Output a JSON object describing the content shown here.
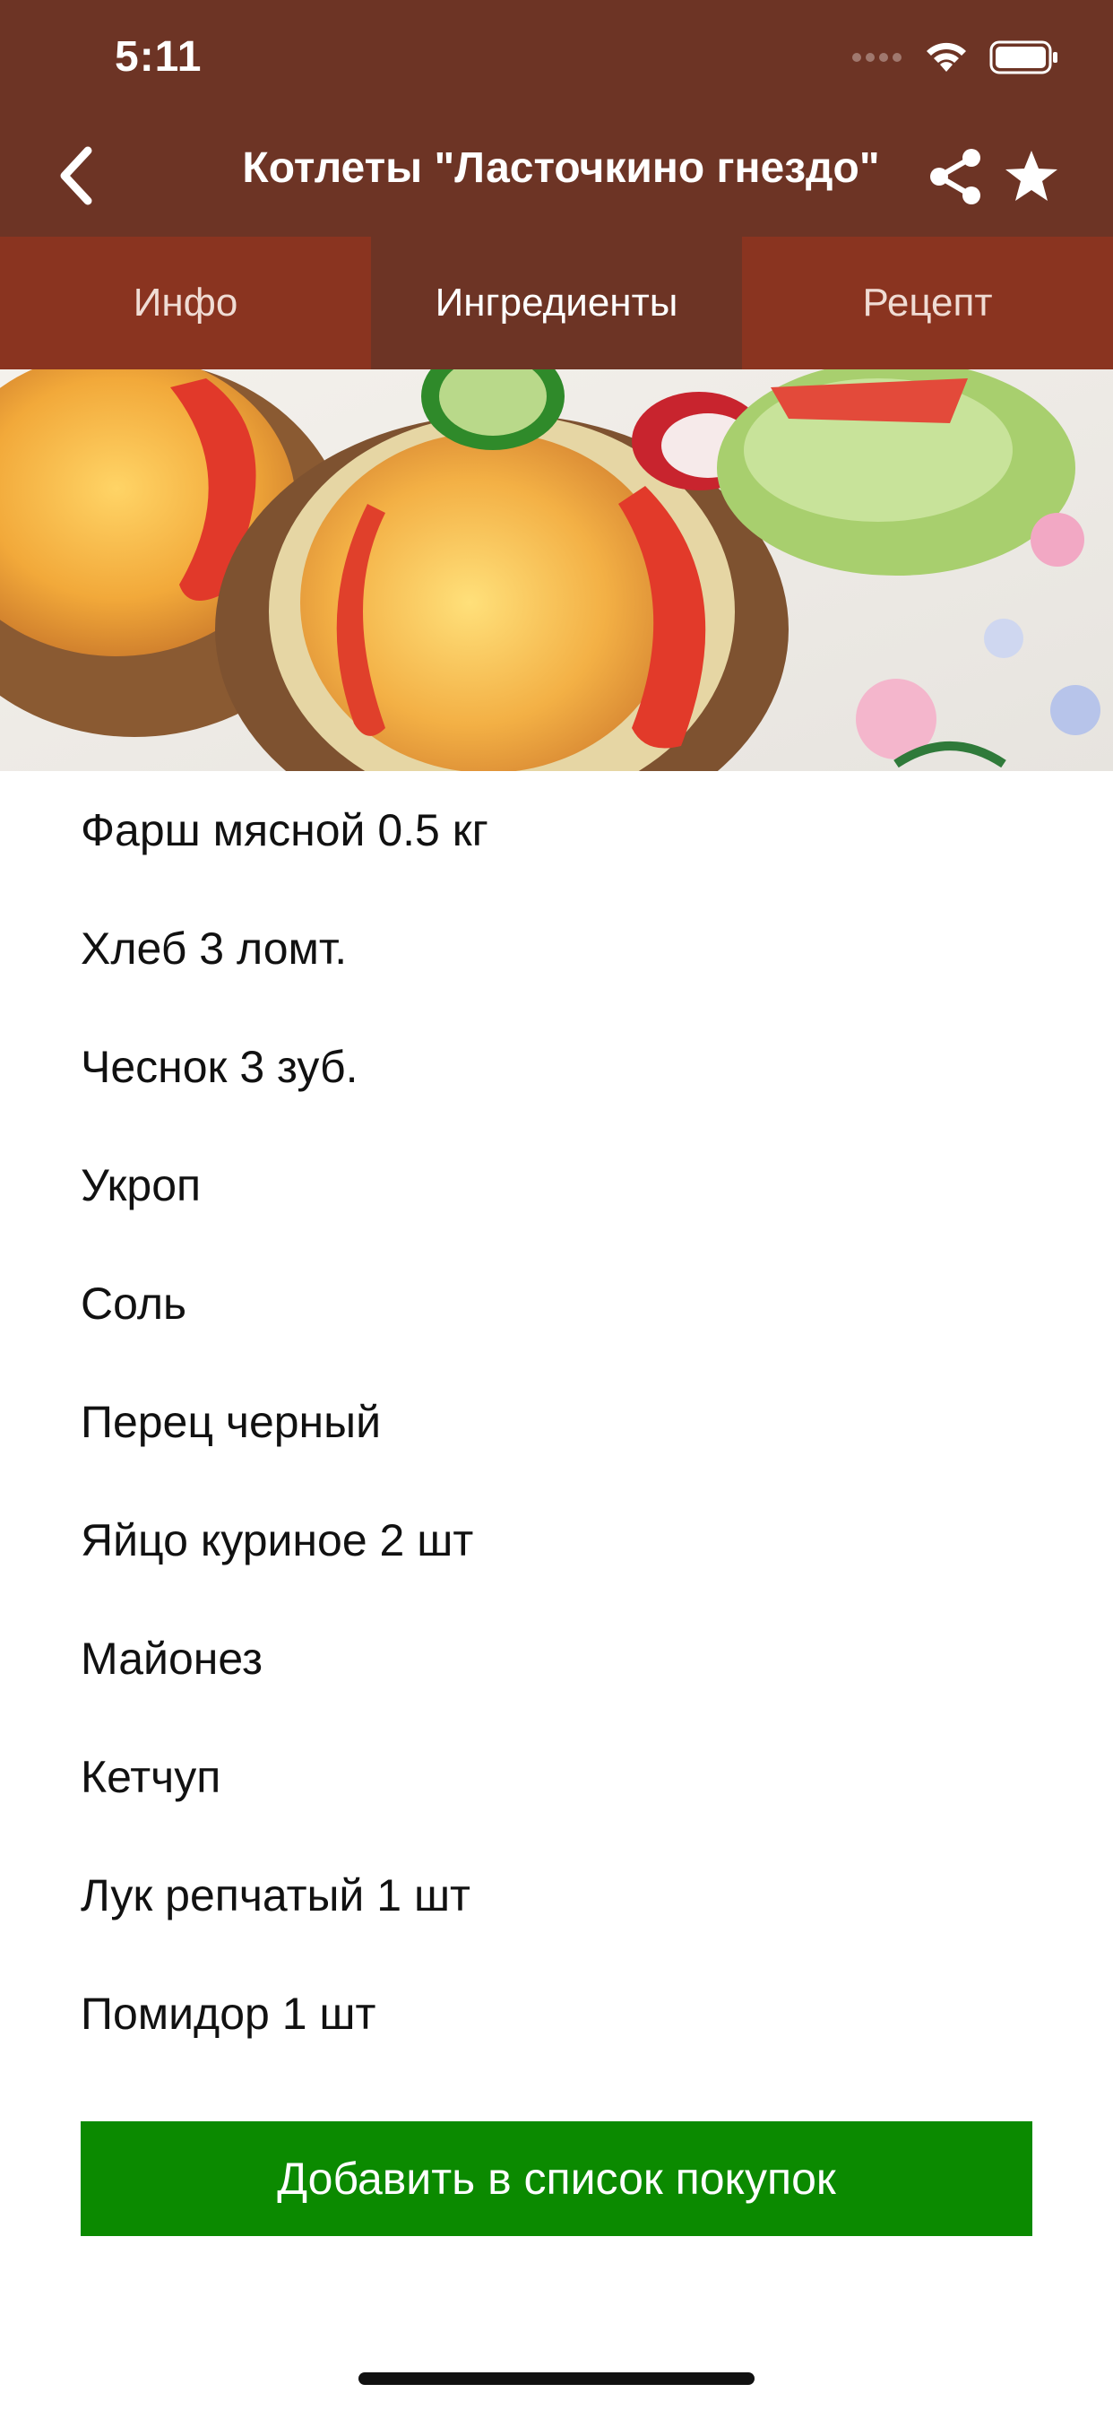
{
  "status_bar": {
    "time": "5:11"
  },
  "nav": {
    "title": "Котлеты \"Ласточкино гнездо\"",
    "back_icon": "chevron-left-icon",
    "share_icon": "share-icon",
    "favorite_icon": "star-icon"
  },
  "tabs": [
    {
      "label": "Инфо",
      "active": false
    },
    {
      "label": "Ингредиенты",
      "active": true
    },
    {
      "label": "Рецепт",
      "active": false
    }
  ],
  "ingredients": [
    "Фарш мясной 0.5 кг",
    "Хлеб 3 ломт.",
    "Чеснок 3 зуб.",
    "Укроп",
    "Соль",
    "Перец черный",
    "Яйцо куриное 2 шт",
    "Майонез",
    "Кетчуп",
    "Лук репчатый 1 шт",
    "Помидор 1 шт"
  ],
  "actions": {
    "add_to_shopping_list": "Добавить в список покупок"
  },
  "colors": {
    "header": "#6d3425",
    "tab_inactive": "#8a3420",
    "button_green": "#0b8a00"
  }
}
